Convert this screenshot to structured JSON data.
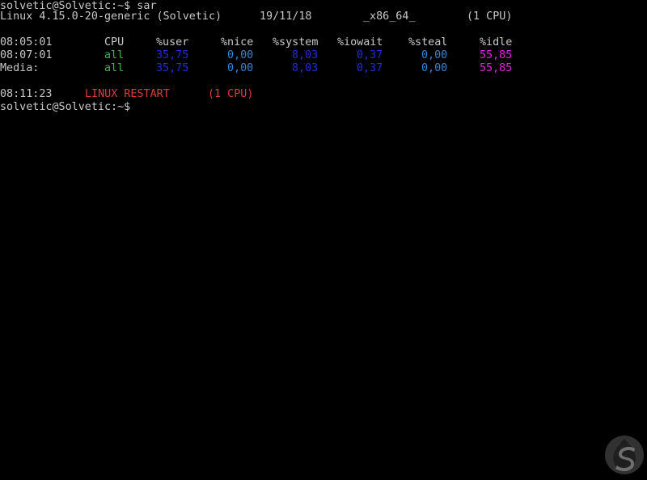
{
  "terminal": {
    "prompt_1": "solvetic@Solvetic:~$ sar",
    "sysinfo": {
      "kernel": "Linux 4.15.0-20-generic (Solvetic)",
      "date": "19/11/18",
      "arch": "_x86_64_",
      "cpus": "(1 CPU)"
    },
    "header": {
      "time": "08:05:01",
      "cpu": "CPU",
      "user": "%user",
      "nice": "%nice",
      "system": "%system",
      "iowait": "%iowait",
      "steal": "%steal",
      "idle": "%idle"
    },
    "rows": [
      {
        "time": "08:07:01",
        "cpu": "all",
        "user": "35,75",
        "nice": "0,00",
        "system": "8,03",
        "iowait": "0,37",
        "steal": "0,00",
        "idle": "55,85"
      },
      {
        "time": "Media:",
        "cpu": "all",
        "user": "35,75",
        "nice": "0,00",
        "system": "8,03",
        "iowait": "0,37",
        "steal": "0,00",
        "idle": "55,85"
      }
    ],
    "restart": {
      "time": "08:11:23",
      "label": "LINUX RESTART",
      "cpus": "(1 CPU)"
    },
    "prompt_2": "solvetic@Solvetic:~$"
  },
  "colors": {
    "background": "#000000",
    "default_text": "#c8c8c8",
    "cpu_all": "#3fb24a",
    "user": "#1f2bd6",
    "nice": "#2f86d6",
    "system": "#1f2bd6",
    "iowait": "#1f2bd6",
    "steal": "#2f86d6",
    "idle": "#e020e0",
    "restart": "#e03a3a"
  },
  "watermark": {
    "icon": "solvetic-logo-icon"
  }
}
